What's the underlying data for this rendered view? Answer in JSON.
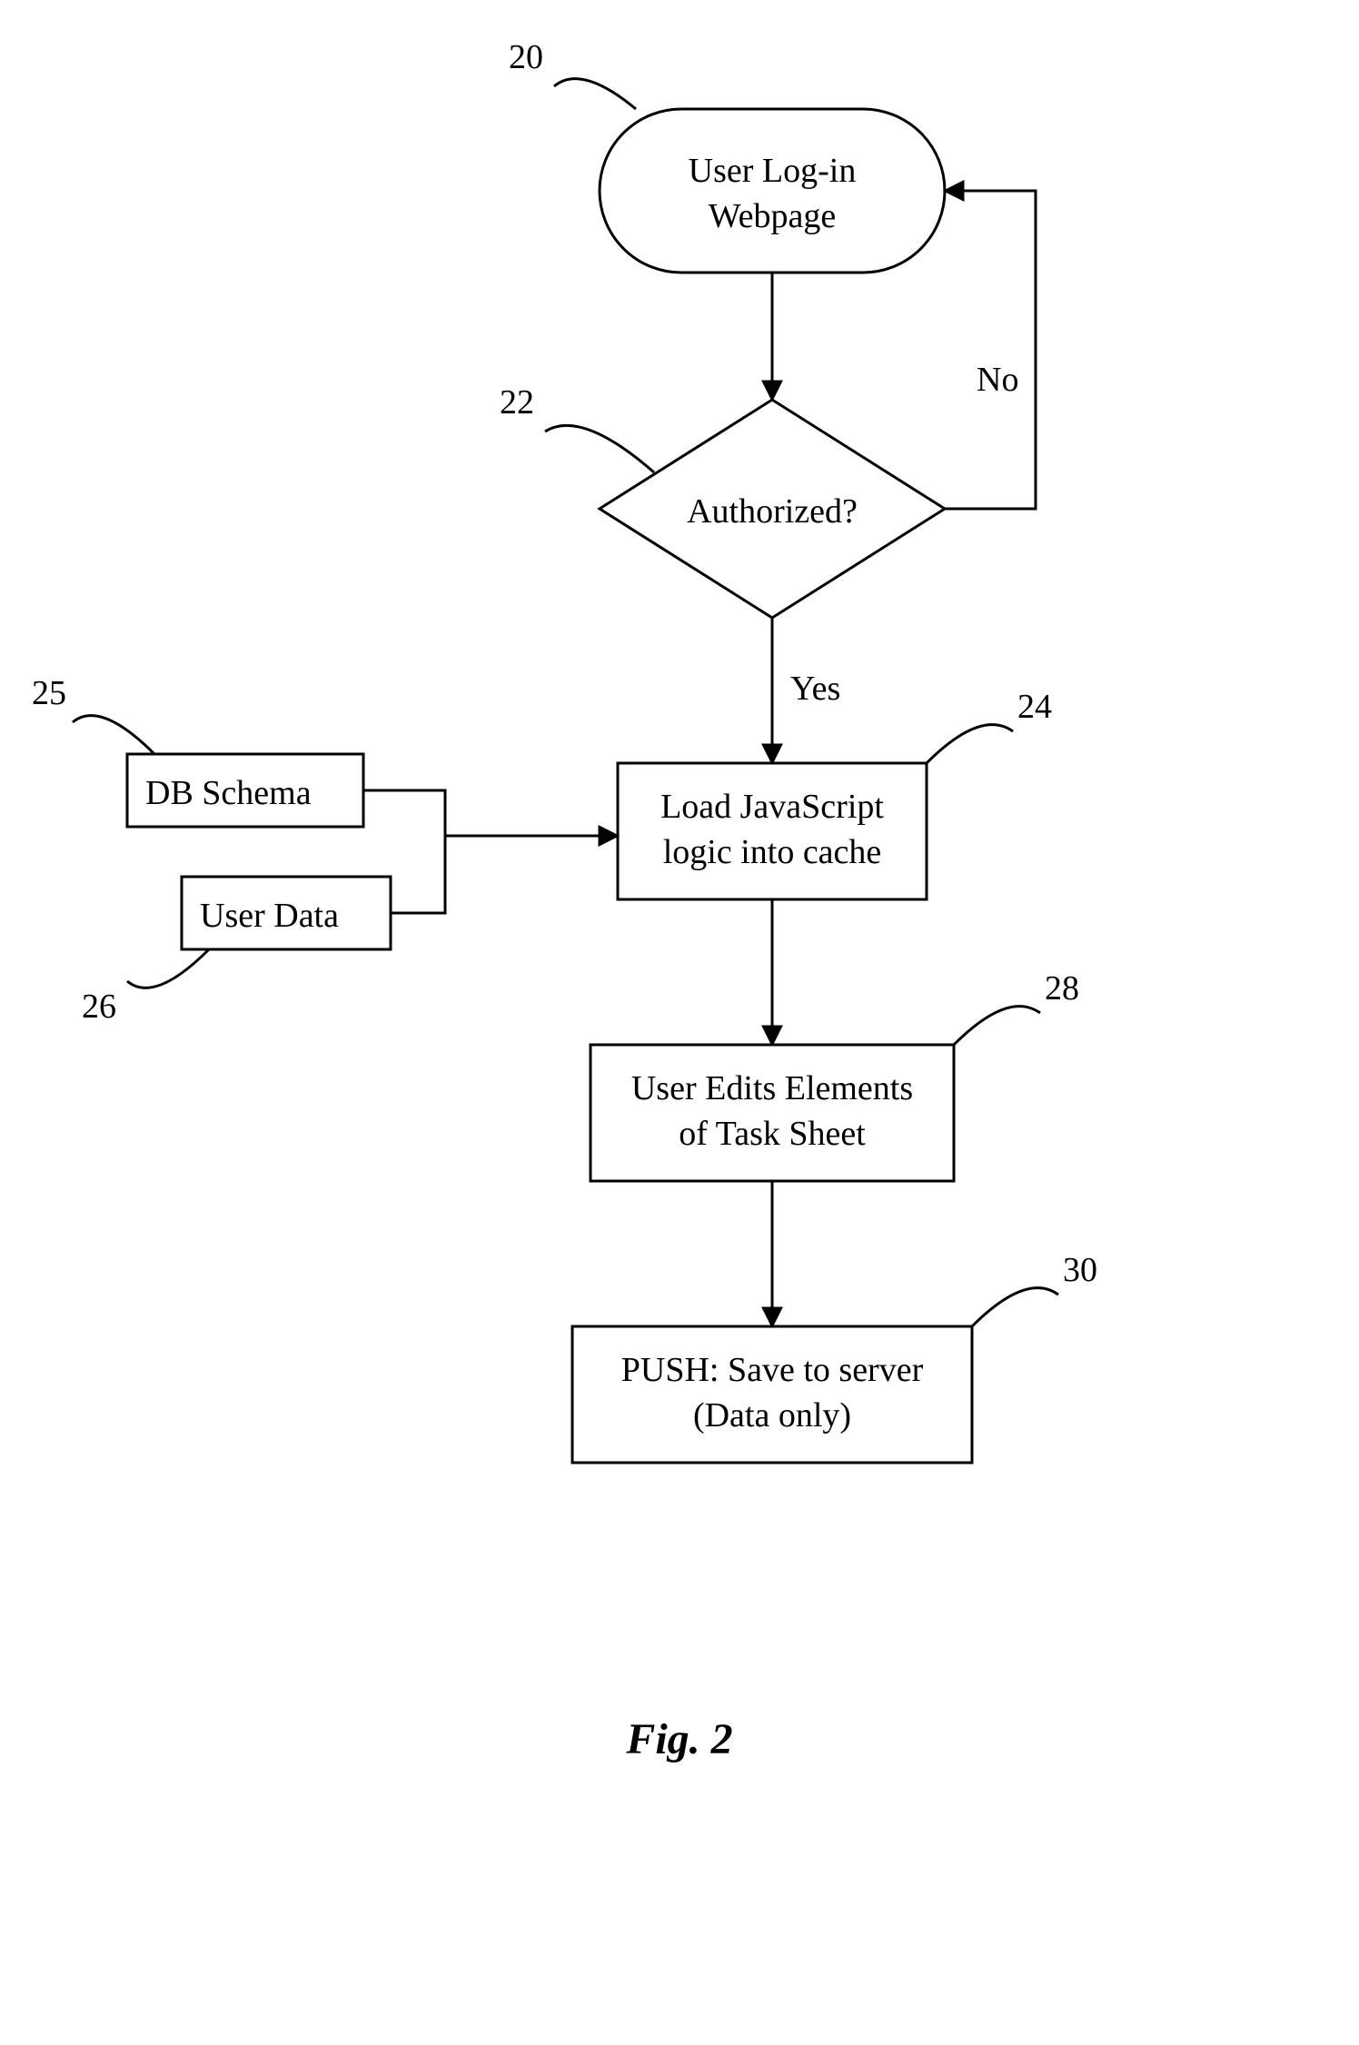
{
  "nodes": {
    "start": {
      "ref": "20",
      "line1": "User Log-in",
      "line2": "Webpage"
    },
    "decision": {
      "ref": "22",
      "text": "Authorized?"
    },
    "load": {
      "ref": "24",
      "line1": "Load JavaScript",
      "line2": "logic into cache"
    },
    "schema": {
      "ref": "25",
      "text": "DB Schema"
    },
    "userdata": {
      "ref": "26",
      "text": "User Data"
    },
    "edit": {
      "ref": "28",
      "line1": "User Edits Elements",
      "line2": "of Task Sheet"
    },
    "push": {
      "ref": "30",
      "line1": "PUSH: Save to server",
      "line2": "(Data only)"
    }
  },
  "edges": {
    "no": "No",
    "yes": "Yes"
  },
  "caption": "Fig. 2"
}
